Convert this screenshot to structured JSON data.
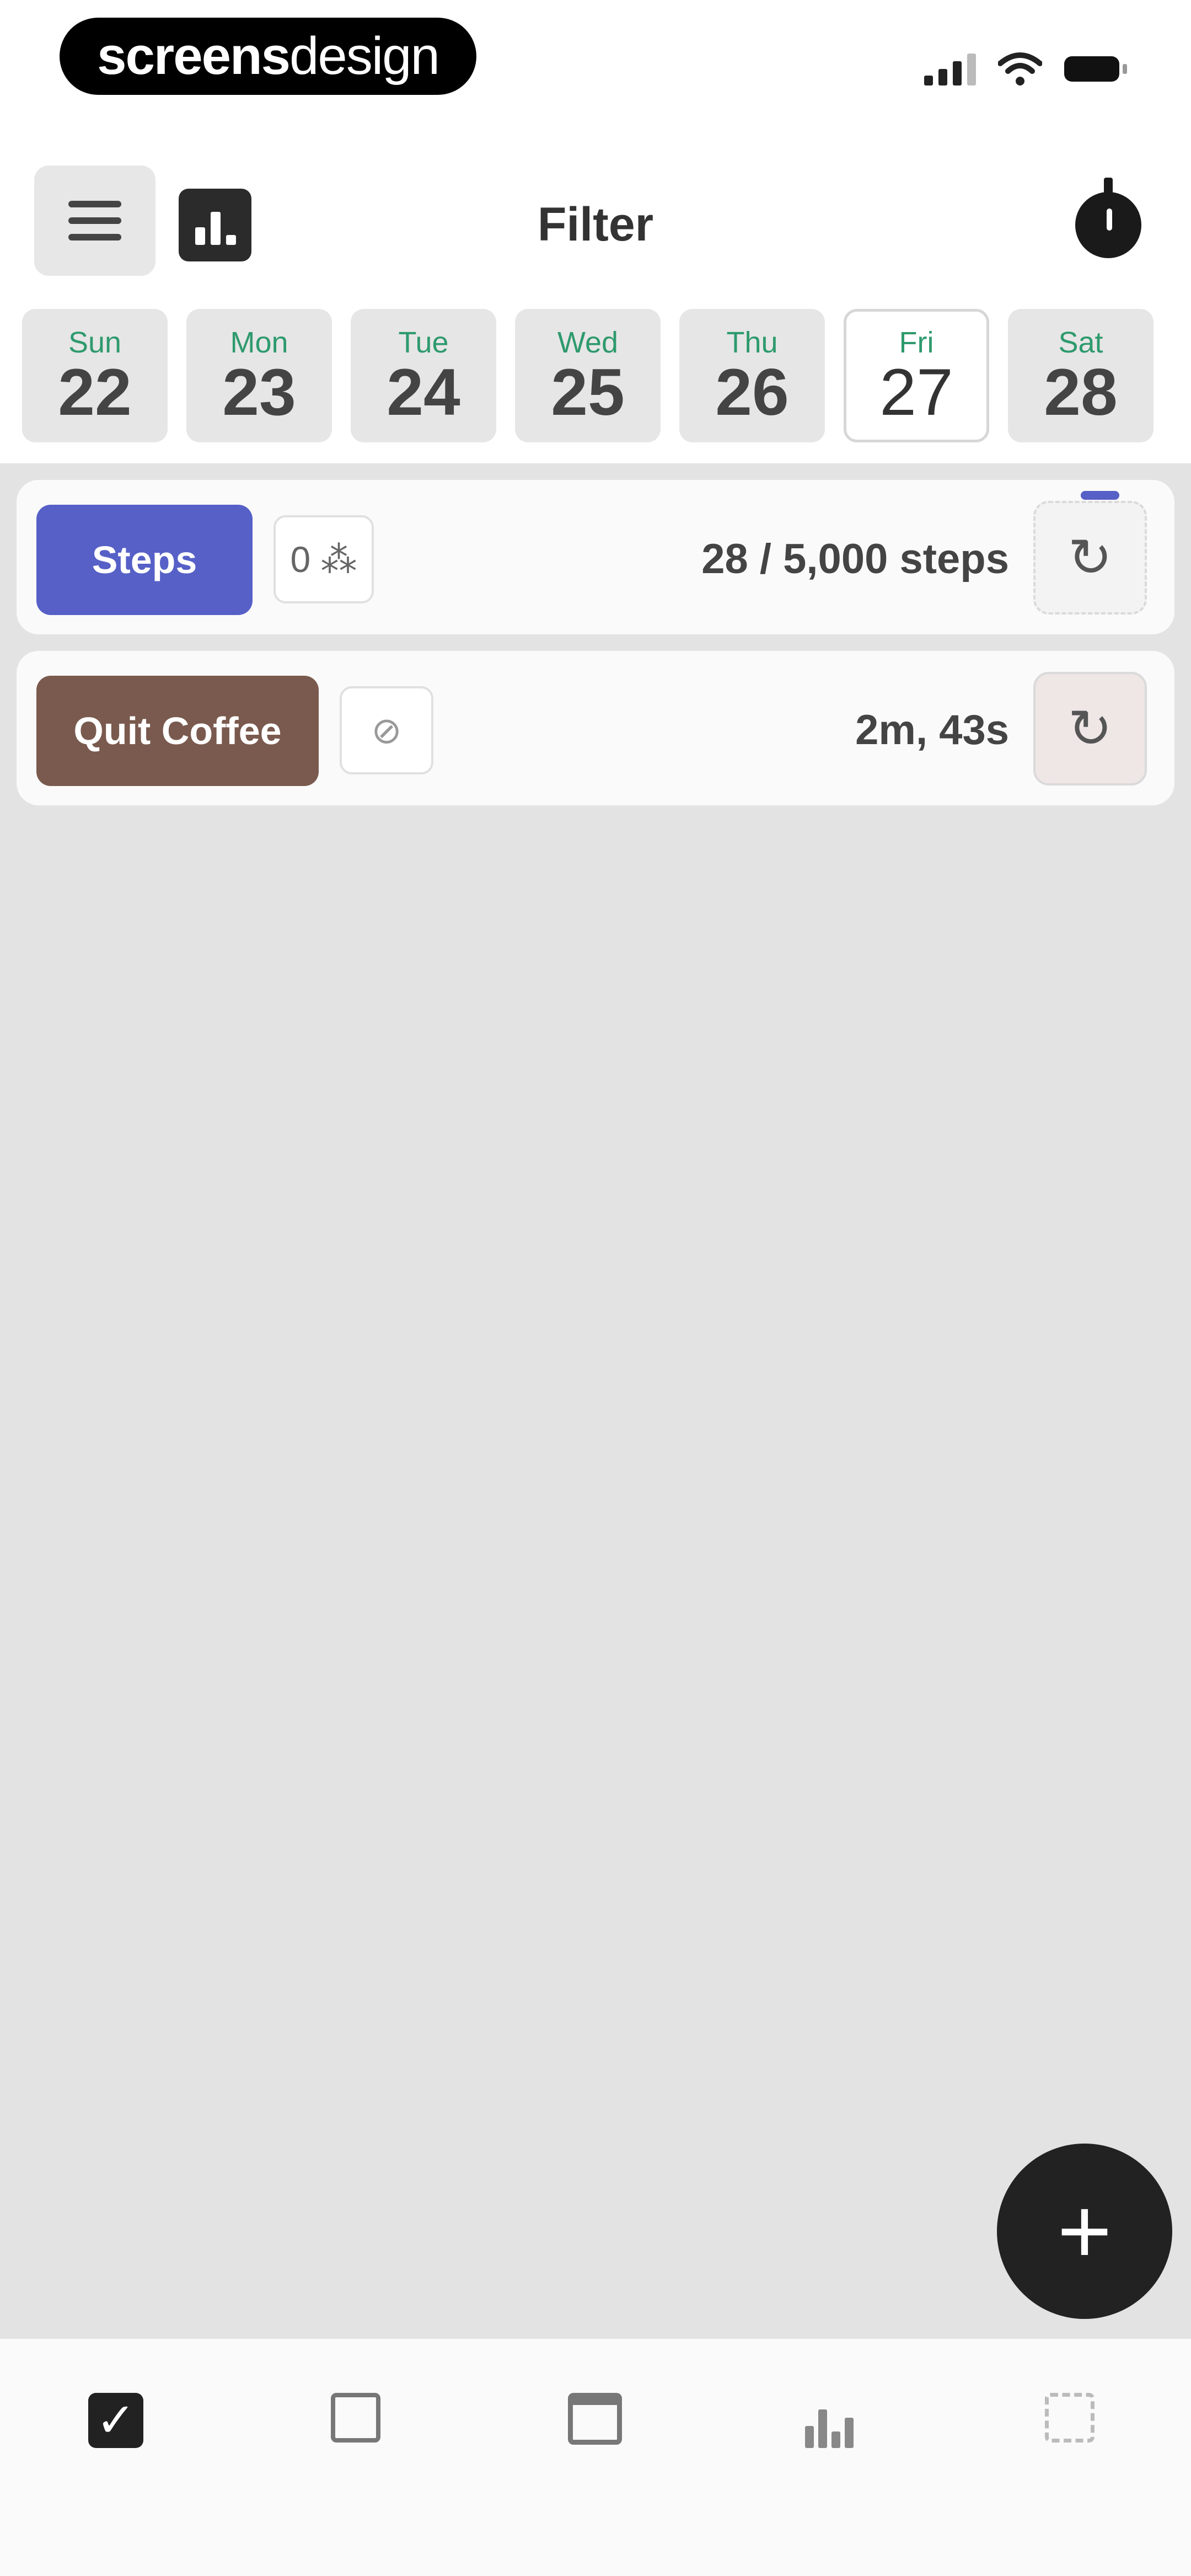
{
  "status_bar": {
    "brand_bold": "screens",
    "brand_light": "design"
  },
  "header": {
    "title": "Filter",
    "menu_icon": "hamburger-menu-icon",
    "stats_icon": "bar-chart-icon",
    "timer_icon": "stopwatch-icon"
  },
  "days": [
    {
      "name": "Sun",
      "num": "22"
    },
    {
      "name": "Mon",
      "num": "23"
    },
    {
      "name": "Tue",
      "num": "24"
    },
    {
      "name": "Wed",
      "num": "25"
    },
    {
      "name": "Thu",
      "num": "26"
    },
    {
      "name": "Fri",
      "num": "27"
    },
    {
      "name": "Sat",
      "num": "28"
    }
  ],
  "selected_day": "Fri",
  "habits": [
    {
      "label": "Steps",
      "color": "#5660c7",
      "chip": "0 ⁂",
      "value": "28 / 5,000 steps"
    },
    {
      "label": "Quit Coffee",
      "color": "#7a5a4e",
      "chip": "⊘",
      "value": "2m, 43s"
    }
  ],
  "fab": {
    "label": "+"
  },
  "tabbar": {
    "items": [
      "checkbox-icon",
      "journal-icon",
      "calendar-icon",
      "stats-icon",
      "settings-icon"
    ]
  },
  "colors": {
    "accent_green": "#2e9a6d",
    "steps_blue": "#5660c7",
    "coffee_brown": "#7a5a4e",
    "background_gray": "#e3e3e3"
  }
}
